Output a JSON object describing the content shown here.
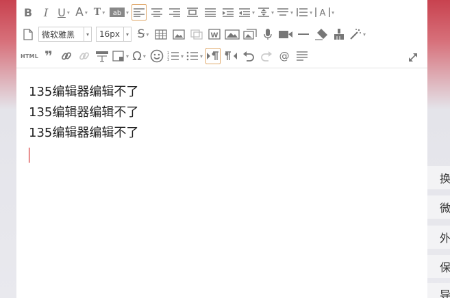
{
  "toolbar": {
    "font_family": "微软雅黑",
    "font_size": "16px",
    "html_label": "HTML",
    "omega_glyph": "Ω",
    "quote_glyph": "❞",
    "at_glyph": "@"
  },
  "content": {
    "lines": [
      "135编辑器编辑不了",
      "135编辑器编辑不了",
      "135编辑器编辑不了"
    ]
  },
  "side_panel": {
    "items": [
      "换",
      "微",
      "外",
      "保",
      "导"
    ]
  }
}
